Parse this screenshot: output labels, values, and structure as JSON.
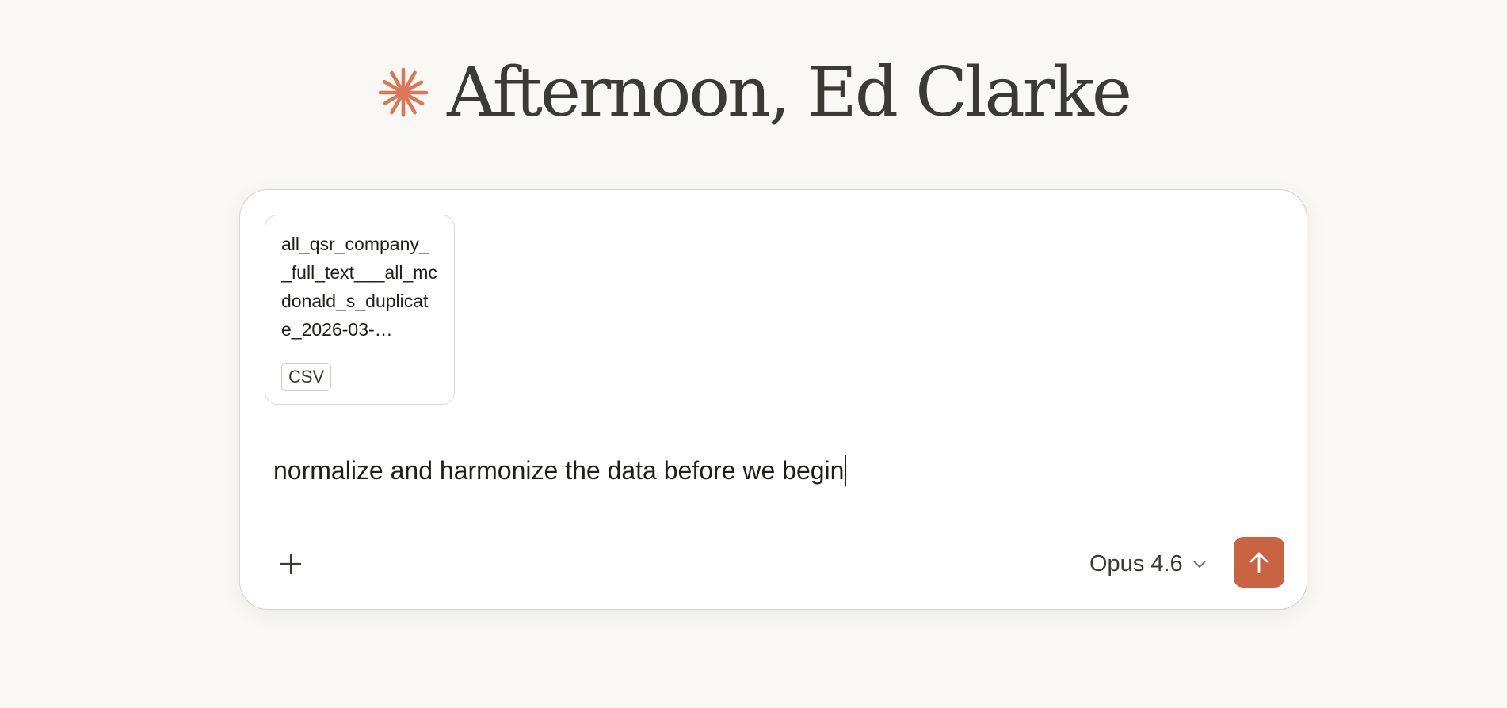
{
  "greeting": {
    "text": "Afternoon, Ed Clarke",
    "logo_icon": "claude-spark-icon",
    "logo_color": "#d97757"
  },
  "composer": {
    "attachment": {
      "file_name": "all_qsr_company__full_text___all_mcdonald_s_duplicate_2026-03-…",
      "file_type": "CSV"
    },
    "message": "normalize and harmonize the data before we begin",
    "add_icon": "plus-icon",
    "model": {
      "label": "Opus 4.6",
      "icon": "chevron-down-icon"
    },
    "send": {
      "icon": "arrow-up-icon",
      "color": "#c96442"
    }
  }
}
